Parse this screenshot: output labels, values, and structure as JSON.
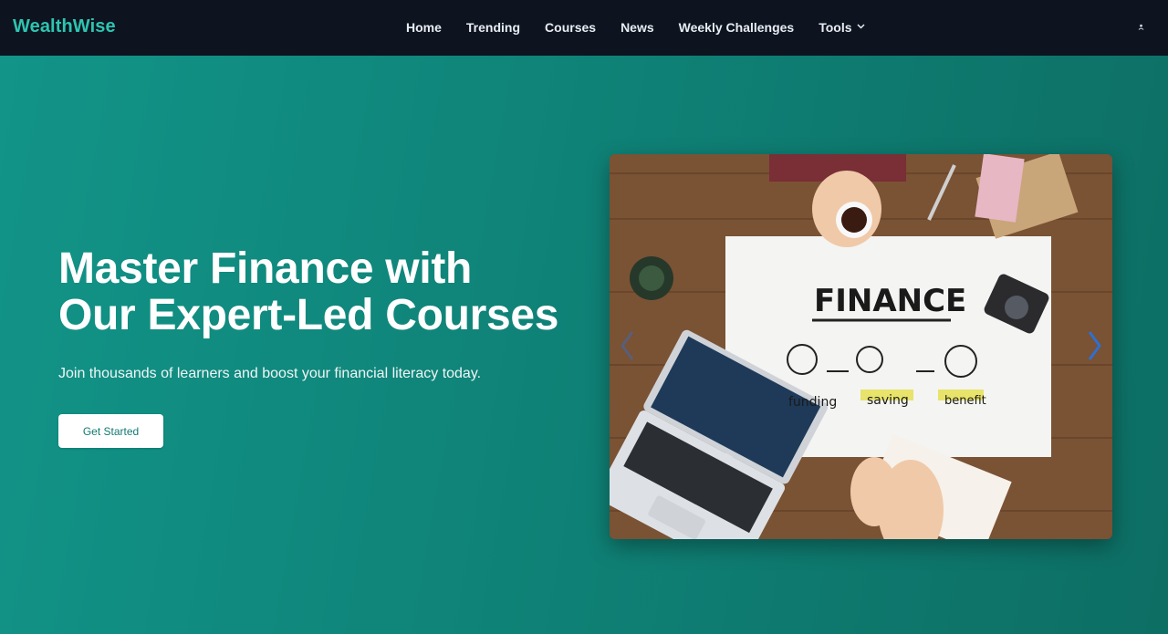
{
  "navbar": {
    "brand": "WealthWise",
    "links": [
      {
        "label": "Home"
      },
      {
        "label": "Trending"
      },
      {
        "label": "Courses"
      },
      {
        "label": "News"
      },
      {
        "label": "Weekly Challenges"
      },
      {
        "label": "Tools",
        "has_dropdown": true
      }
    ],
    "account_icon": "user-icon"
  },
  "hero": {
    "headline_line1": "Master Finance with",
    "headline_line2": "Our Expert-Led Courses",
    "subtitle": "Join thousands of learners and boost your financial literacy today.",
    "cta_label": "Get Started"
  },
  "carousel": {
    "slide": {
      "board_title": "FINANCE",
      "labels": [
        "funding",
        "saving",
        "benefit"
      ]
    },
    "prev_icon": "chevron-left-icon",
    "next_icon": "chevron-right-icon"
  },
  "colors": {
    "nav_bg": "#0d1420",
    "brand": "#2ec4b0",
    "hero_bg": "#0f8176",
    "cta_text": "#127a70"
  }
}
